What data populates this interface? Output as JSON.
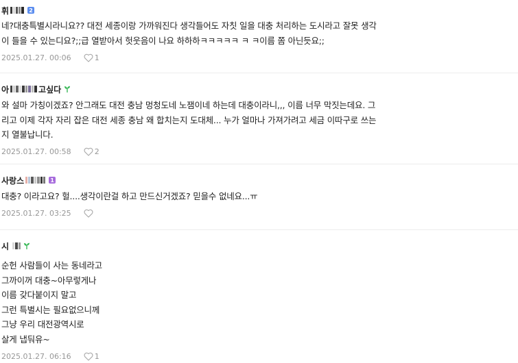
{
  "comments": [
    {
      "author": "휘",
      "badge": "2",
      "badge_color": "#5b8def",
      "text_lines": [
        "네?대충특별시라니요?? 대전 세종이랑 가까워진다 생각들어도 자칫 일을 대충 처리하는 도시라고 잘못 생각",
        "이 들을 수 있는디요?;;급 열받아서 헛웃음이 나요 하하하ㅋㅋㅋㅋㅋ ㅋ ㅋ이름 쫌 아닌듯요;;"
      ],
      "date": "2025.01.27. 00:06",
      "likes": "1"
    },
    {
      "author_prefix": "아",
      "author_suffix": "고싶다",
      "text_lines": [
        "와 설마 가칭이겠죠? 안그래도 대전 충남 멍청도네 노잼이네 하는데 대충이라니,,, 이름 너무 막짓는데요. 그",
        "리고 이제 각자 자리 잡은 대전 세종 충남 왜 합치는지 도대체... 누가 얼마나 가져가려고 세금 이따구로 쓰는",
        "지 열불납니다."
      ],
      "date": "2025.01.27. 00:58",
      "likes": "2"
    },
    {
      "author": "사랑스",
      "badge": "1",
      "badge_color": "#a66bdc",
      "text_lines": [
        "대충? 이라고요? 헐....생각이란걸 하고 만드신거겠죠? 믿을수 없네요...ㅠ"
      ],
      "date": "2025.01.27. 03:25",
      "likes": ""
    },
    {
      "author": "시",
      "text_lines": [
        "순헌 사람들이 사는 동네라고",
        "그까이꺼 대충~아무렇게나",
        "이름 갖다붙이지 말고",
        "그런 특별시는 필요없으니께",
        "그냥 우리 대전광역시로",
        "살게 냅둬유~"
      ],
      "date": "2025.01.27. 06:16",
      "likes": "1"
    }
  ],
  "icons": {
    "like": "heart-outline-icon",
    "sprout": "sprout-icon"
  },
  "colors": {
    "meta_text": "#979797",
    "divider": "#ececec",
    "sprout": "#3cb95a"
  }
}
